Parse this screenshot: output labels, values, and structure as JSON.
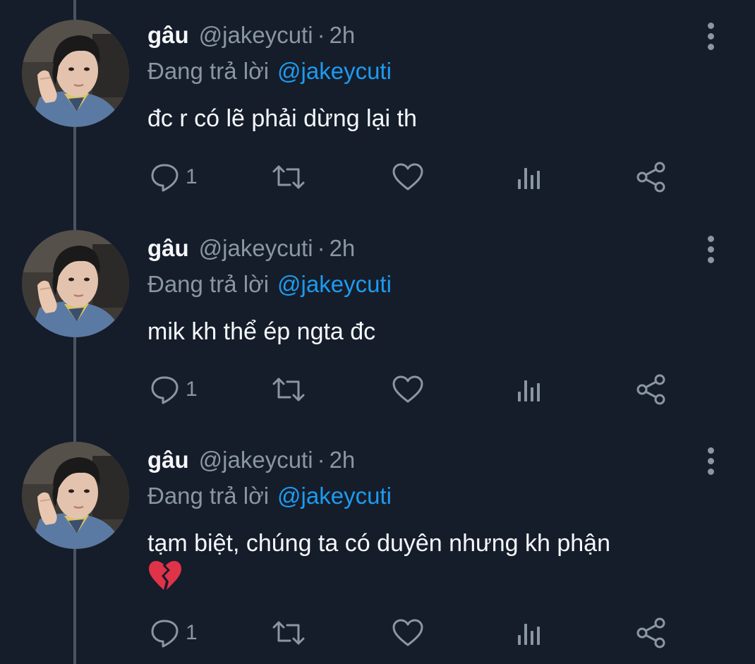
{
  "tweets": [
    {
      "name": "gâu",
      "handle": "@jakeycuti",
      "separator": "·",
      "time": "2h",
      "reply_prefix": "Đang trả lời",
      "reply_to": "@jakeycuti",
      "text": "đc r có lẽ phải dừng lại th",
      "emoji": "",
      "reply_count": "1"
    },
    {
      "name": "gâu",
      "handle": "@jakeycuti",
      "separator": "·",
      "time": "2h",
      "reply_prefix": "Đang trả lời",
      "reply_to": "@jakeycuti",
      "text": "mik kh thể ép ngta đc",
      "emoji": "",
      "reply_count": "1"
    },
    {
      "name": "gâu",
      "handle": "@jakeycuti",
      "separator": "·",
      "time": "2h",
      "reply_prefix": "Đang trả lời",
      "reply_to": "@jakeycuti",
      "text": "tạm biệt, chúng ta có duyên nhưng kh phận",
      "emoji": "broken-heart-icon",
      "reply_count": "1"
    }
  ],
  "icons": {
    "reply": "comment-icon",
    "retweet": "retweet-icon",
    "like": "heart-icon",
    "analytics": "analytics-icon",
    "share": "share-icon",
    "more": "more-vertical-icon"
  },
  "colors": {
    "background": "#151d2a",
    "primary_text": "#f5f7fa",
    "secondary_text": "#8a96a3",
    "link": "#1d9bf0",
    "thread_line": "#4a5462",
    "broken_heart": "#e0334a"
  }
}
